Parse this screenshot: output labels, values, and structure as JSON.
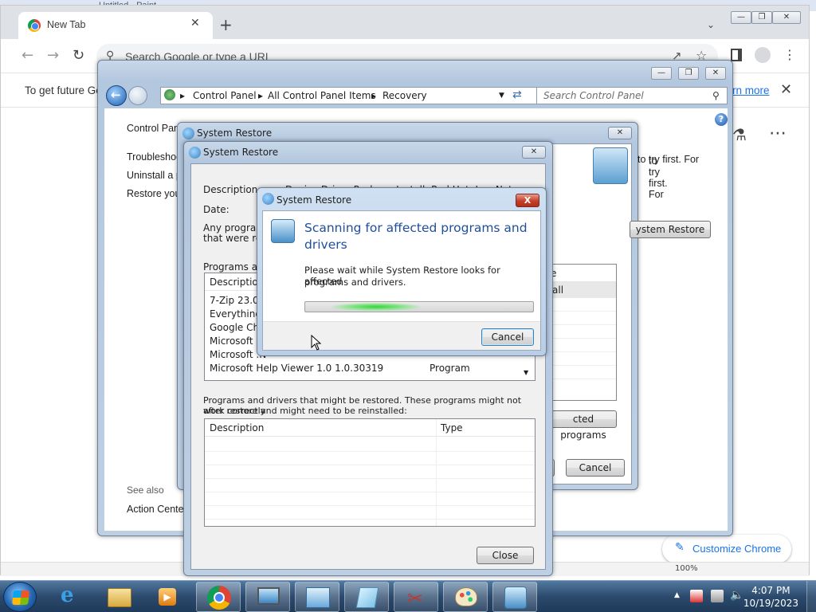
{
  "paint": {
    "title": "Untitled - Paint"
  },
  "chrome": {
    "tab_title": "New Tab",
    "tab_close": "✕",
    "new_tab": "+",
    "omnibox_placeholder": "Search Google or type a URL",
    "infobar_message": "To get future Go",
    "infobar_link": "rn more",
    "infobar_close": "✕",
    "customize": "Customize Chrome",
    "zoom": "100%"
  },
  "control_panel": {
    "breadcrumb": [
      "Control Panel",
      "All Control Panel Items",
      "Recovery"
    ],
    "search_placeholder": "Search Control Panel",
    "sidebar": {
      "home": "Control Pan",
      "links": [
        "Troubleshoo",
        "Uninstall a p",
        "Restore you"
      ],
      "see_also": "See also",
      "action_center": "Action Center"
    },
    "right_text": "to try first. For",
    "open_system_restore": "ystem Restore"
  },
  "sr_back": {
    "title": "System Restore",
    "column_partial": "e",
    "row_partial": "all",
    "detected_programs": "cted programs",
    "cancel": "Cancel"
  },
  "sr_main": {
    "title": "System Restore",
    "description_label": "Description:",
    "description_value": "Device Driver Package Install: Red Hat, Inc. Network adapters",
    "date_label": "Date:",
    "any_programs": "Any programs",
    "that_were": "that were rem",
    "programs_deleted": "Programs and",
    "list_columns": [
      "Description",
      "Type"
    ],
    "deleted_rows": [
      {
        "name": "7-Zip 23.01",
        "type": ""
      },
      {
        "name": "Everything 1",
        "type": ""
      },
      {
        "name": "Google Chro",
        "type": ""
      },
      {
        "name": "Microsoft .N",
        "type": ""
      },
      {
        "name": "Microsoft .N",
        "type": ""
      },
      {
        "name": "Microsoft Help Viewer 1.0 1.0.30319",
        "type": "Program"
      }
    ],
    "restored_text_1": "Programs and drivers that might be restored. These programs might not work correctly",
    "restored_text_2": "after restore and might need to be reinstalled:",
    "close": "Close"
  },
  "scan_dialog": {
    "title": "System Restore",
    "close_x": "X",
    "heading_1": "Scanning for affected programs and",
    "heading_2": "drivers",
    "body_1": "Please wait while System Restore looks for affected",
    "body_2": "programs and drivers.",
    "progress_indeterminate": true,
    "cancel": "Cancel"
  },
  "taskbar": {
    "time": "4:07 PM",
    "date": "10/19/2023",
    "apps": [
      "internet-explorer",
      "file-explorer",
      "media-player",
      "chrome",
      "remote-desktop",
      "control-panel",
      "notes",
      "snipping-tool",
      "paint",
      "system-restore"
    ]
  }
}
